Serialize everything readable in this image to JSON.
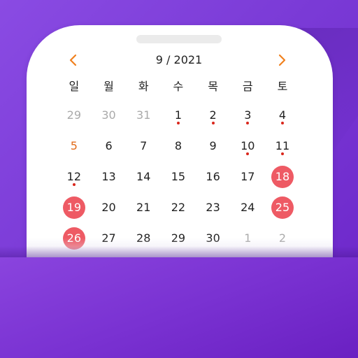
{
  "calendar": {
    "month_label": "9 / 2021",
    "prev_icon": "chevron-left-icon",
    "next_icon": "chevron-right-icon",
    "weekdays": [
      "일",
      "월",
      "화",
      "수",
      "목",
      "금",
      "토"
    ],
    "weeks": [
      [
        {
          "d": "29",
          "muted": true
        },
        {
          "d": "30",
          "muted": true
        },
        {
          "d": "31",
          "muted": true
        },
        {
          "d": "1",
          "dot": true
        },
        {
          "d": "2",
          "dot": true
        },
        {
          "d": "3",
          "dot": true
        },
        {
          "d": "4",
          "dot": true
        }
      ],
      [
        {
          "d": "5",
          "orange": true
        },
        {
          "d": "6"
        },
        {
          "d": "7"
        },
        {
          "d": "8"
        },
        {
          "d": "9"
        },
        {
          "d": "10",
          "dot": true
        },
        {
          "d": "11",
          "dot": true
        }
      ],
      [
        {
          "d": "12",
          "dot": true
        },
        {
          "d": "13"
        },
        {
          "d": "14"
        },
        {
          "d": "15"
        },
        {
          "d": "16"
        },
        {
          "d": "17"
        },
        {
          "d": "18",
          "highlight": true
        }
      ],
      [
        {
          "d": "19",
          "highlight": true
        },
        {
          "d": "20"
        },
        {
          "d": "21"
        },
        {
          "d": "22"
        },
        {
          "d": "23"
        },
        {
          "d": "24"
        },
        {
          "d": "25",
          "highlight": true
        }
      ],
      [
        {
          "d": "26",
          "highlight": true
        },
        {
          "d": "27"
        },
        {
          "d": "28"
        },
        {
          "d": "29"
        },
        {
          "d": "30"
        },
        {
          "d": "1",
          "muted": true
        },
        {
          "d": "2",
          "muted": true
        }
      ]
    ]
  },
  "colors": {
    "background": "#7a3ad6",
    "accent_nav": "#f0801e",
    "highlight": "#ee5a64",
    "event_dot": "#d9261c",
    "sunday_holiday": "#e26b1a",
    "muted_text": "#aaaaaa"
  }
}
